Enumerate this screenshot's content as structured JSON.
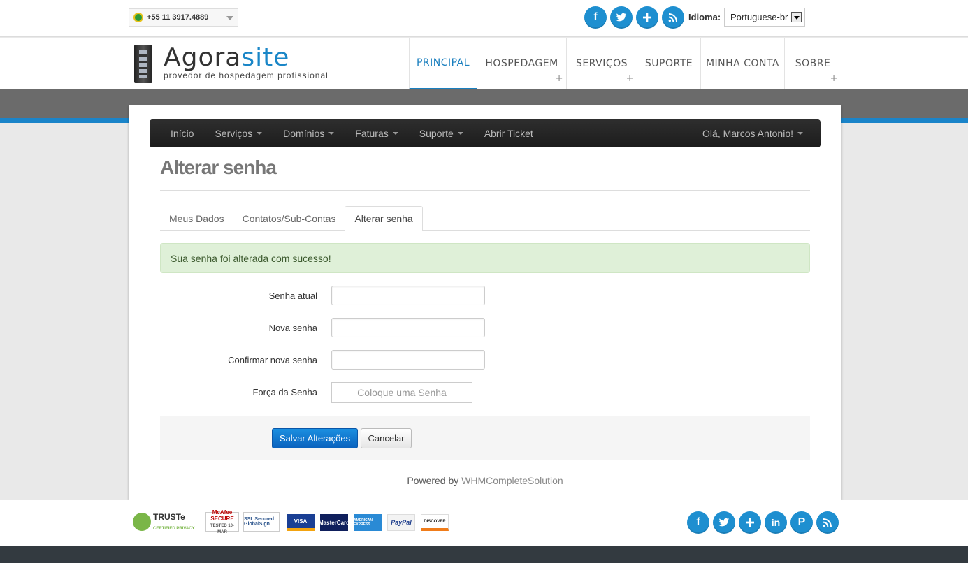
{
  "topbar": {
    "phone": "+55 11 3917.4889",
    "language_label": "Idioma:",
    "language_value": "Portuguese-br",
    "social_icons": [
      "facebook-icon",
      "twitter-icon",
      "plus-icon",
      "rss-icon"
    ]
  },
  "header": {
    "logo_name_1": "Agora",
    "logo_name_2": "site",
    "logo_tagline": "provedor de hospedagem profissional",
    "nav": [
      {
        "label": "PRINCIPAL",
        "active": true,
        "has_sub": false
      },
      {
        "label": "HOSPEDAGEM",
        "active": false,
        "has_sub": true
      },
      {
        "label": "SERVIÇOS",
        "active": false,
        "has_sub": true
      },
      {
        "label": "SUPORTE",
        "active": false,
        "has_sub": false
      },
      {
        "label": "MINHA CONTA",
        "active": false,
        "has_sub": false
      },
      {
        "label": "SOBRE",
        "active": false,
        "has_sub": true
      }
    ],
    "plus_glyph": "+"
  },
  "subnav": {
    "items": [
      "Início",
      "Serviços",
      "Domínios",
      "Faturas",
      "Suporte",
      "Abrir Ticket"
    ],
    "user": "Olá, Marcos Antonio!"
  },
  "page": {
    "title": "Alterar senha",
    "tabs": [
      "Meus Dados",
      "Contatos/Sub-Contas",
      "Alterar senha"
    ],
    "active_tab": 2,
    "alert": "Sua senha foi alterada com sucesso!",
    "fields": {
      "current": {
        "label": "Senha atual",
        "value": ""
      },
      "new": {
        "label": "Nova senha",
        "value": ""
      },
      "confirm": {
        "label": "Confirmar nova senha",
        "value": ""
      },
      "strength": {
        "label": "Força da Senha",
        "value": "Coloque uma Senha"
      }
    },
    "save_label": "Salvar Alterações",
    "cancel_label": "Cancelar",
    "powered_prefix": "Powered by ",
    "powered_link": "WHMCompleteSolution"
  },
  "footer": {
    "seals": {
      "truste": "TRUSTe",
      "truste_sub": "CERTIFIED PRIVACY",
      "mcafee": "McAfee SECURE",
      "mcafee_sub": "TESTED 10-MAR",
      "globalsign": "SSL Secured GlobalSign"
    },
    "cards": [
      "VISA",
      "MasterCard",
      "AMERICAN EXPRESS",
      "PayPal",
      "DISCOVER"
    ],
    "social_icons": [
      "facebook-icon",
      "twitter-icon",
      "plus-icon",
      "linkedin-icon",
      "pinterest-icon",
      "rss-icon"
    ]
  },
  "colors": {
    "accent": "#1a84c9",
    "subnav": "#262626",
    "alert_bg": "#dff0d8",
    "save_button": "#0a62be"
  }
}
